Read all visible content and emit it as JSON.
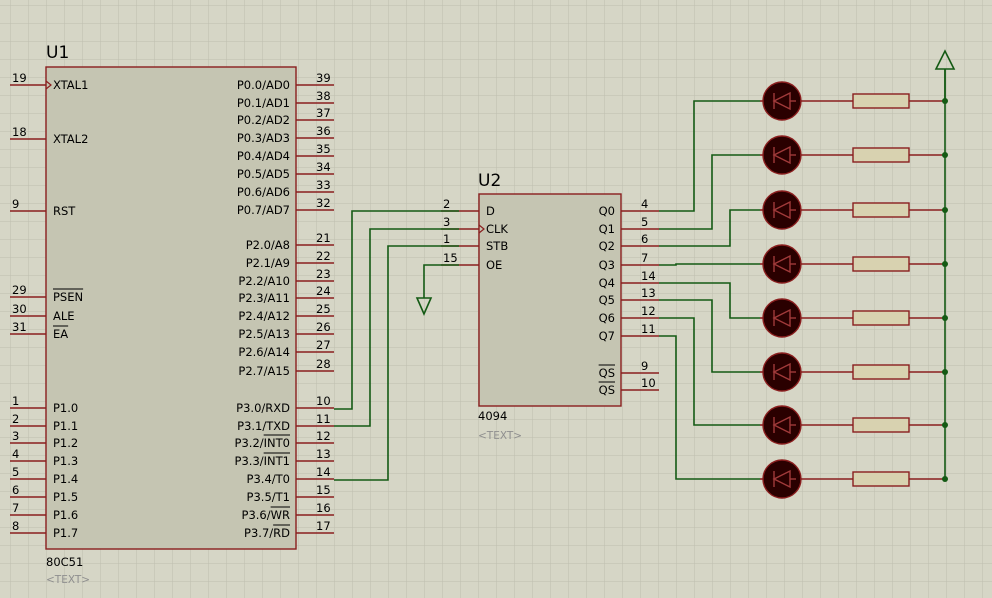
{
  "u1": {
    "ref": "U1",
    "part": "80C51",
    "placeholder": "<TEXT>",
    "left_pins": [
      {
        "num": "19",
        "name": "XTAL1",
        "clk": true
      },
      {
        "num": "18",
        "name": "XTAL2"
      },
      {
        "num": "9",
        "name": "RST"
      },
      {
        "num": "29",
        "name": "PSEN",
        "over": true
      },
      {
        "num": "30",
        "name": "ALE"
      },
      {
        "num": "31",
        "name": "EA",
        "over": true
      },
      {
        "num": "1",
        "name": "P1.0"
      },
      {
        "num": "2",
        "name": "P1.1"
      },
      {
        "num": "3",
        "name": "P1.2"
      },
      {
        "num": "4",
        "name": "P1.3"
      },
      {
        "num": "5",
        "name": "P1.4"
      },
      {
        "num": "6",
        "name": "P1.5"
      },
      {
        "num": "7",
        "name": "P1.6"
      },
      {
        "num": "8",
        "name": "P1.7"
      }
    ],
    "right_pins": [
      {
        "num": "39",
        "name": "P0.0/AD0"
      },
      {
        "num": "38",
        "name": "P0.1/AD1"
      },
      {
        "num": "37",
        "name": "P0.2/AD2"
      },
      {
        "num": "36",
        "name": "P0.3/AD3"
      },
      {
        "num": "35",
        "name": "P0.4/AD4"
      },
      {
        "num": "34",
        "name": "P0.5/AD5"
      },
      {
        "num": "33",
        "name": "P0.6/AD6"
      },
      {
        "num": "32",
        "name": "P0.7/AD7"
      },
      {
        "num": "21",
        "name": "P2.0/A8"
      },
      {
        "num": "22",
        "name": "P2.1/A9"
      },
      {
        "num": "23",
        "name": "P2.2/A10"
      },
      {
        "num": "24",
        "name": "P2.3/A11"
      },
      {
        "num": "25",
        "name": "P2.4/A12"
      },
      {
        "num": "26",
        "name": "P2.5/A13"
      },
      {
        "num": "27",
        "name": "P2.6/A14"
      },
      {
        "num": "28",
        "name": "P2.7/A15"
      },
      {
        "num": "10",
        "name": "P3.0/RXD"
      },
      {
        "num": "11",
        "name": "P3.1/TXD"
      },
      {
        "num": "12",
        "name": "P3.2/",
        "over": "INT0"
      },
      {
        "num": "13",
        "name": "P3.3/",
        "over": "INT1"
      },
      {
        "num": "14",
        "name": "P3.4/T0"
      },
      {
        "num": "15",
        "name": "P3.5/T1"
      },
      {
        "num": "16",
        "name": "P3.6/",
        "over": "WR"
      },
      {
        "num": "17",
        "name": "P3.7/",
        "over": "RD"
      }
    ]
  },
  "u2": {
    "ref": "U2",
    "part": "4094",
    "placeholder": "<TEXT>",
    "left_pins": [
      {
        "num": "2",
        "name": "D"
      },
      {
        "num": "3",
        "name": "CLK",
        "clk": true
      },
      {
        "num": "1",
        "name": "STB"
      },
      {
        "num": "15",
        "name": "OE"
      }
    ],
    "right_pins": [
      {
        "num": "4",
        "name": "Q0"
      },
      {
        "num": "5",
        "name": "Q1"
      },
      {
        "num": "6",
        "name": "Q2"
      },
      {
        "num": "7",
        "name": "Q3"
      },
      {
        "num": "14",
        "name": "Q4"
      },
      {
        "num": "13",
        "name": "Q5"
      },
      {
        "num": "12",
        "name": "Q6"
      },
      {
        "num": "11",
        "name": "Q7"
      },
      {
        "num": "9",
        "name": "QS",
        "over": true
      },
      {
        "num": "10",
        "name": "QS",
        "over": true,
        "overAll": true
      }
    ]
  },
  "leds": {
    "count": 8
  },
  "colors": {
    "background": "#d6d6c6",
    "grid": "#bebeaf",
    "component_outline": "#8a1e1e",
    "component_fill": "#c5c5b2",
    "wire": "#145a14",
    "led_body": "#2a0000",
    "led_outline": "#8a1e1e",
    "resistor_fill": "#d8d2b0"
  },
  "icons": {
    "power": "power-arrow-icon",
    "ground": "ground-arrow-icon",
    "led": "led-diode-icon",
    "resistor": "resistor-icon"
  }
}
